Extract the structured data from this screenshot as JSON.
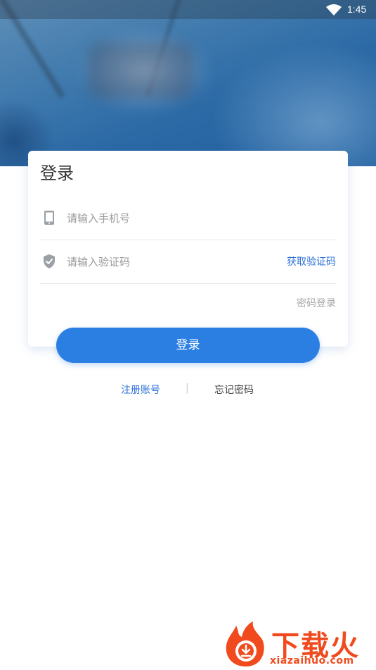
{
  "status_bar": {
    "time": "1:45",
    "wifi_icon": "wifi-icon"
  },
  "login_card": {
    "title": "登录",
    "phone_field": {
      "icon": "phone-icon",
      "placeholder": "请输入手机号"
    },
    "code_field": {
      "icon": "shield-check-icon",
      "placeholder": "请输入验证码",
      "get_code_label": "获取验证码"
    },
    "password_login_label": "密码登录"
  },
  "login_button_label": "登录",
  "links": {
    "register_label": "注册账号",
    "separator": "|",
    "forgot_label": "忘记密码"
  },
  "watermark": {
    "brand": "下载火",
    "url": "xiazaihuo.com"
  },
  "colors": {
    "accent": "#2b7fe3",
    "link": "#2a6fd6",
    "watermark": "#f04a1e"
  }
}
